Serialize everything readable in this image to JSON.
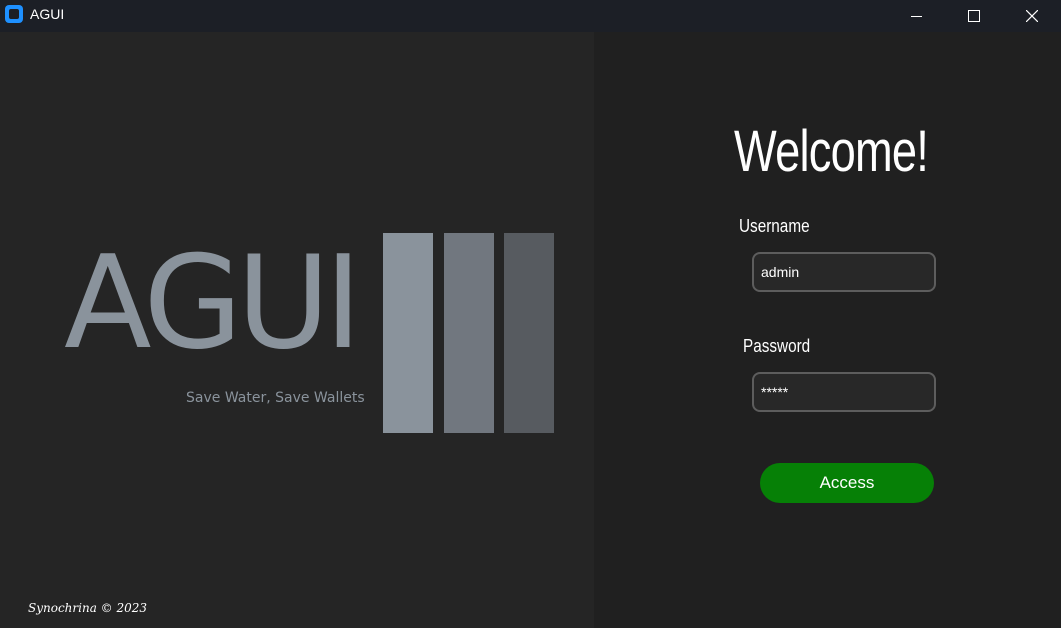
{
  "window": {
    "title": "AGUI"
  },
  "branding": {
    "logo_text": "AGUI",
    "tagline": "Save Water, Save Wallets",
    "copyright": "Synochrina © 2023"
  },
  "login": {
    "heading": "Welcome!",
    "username_label": "Username",
    "username_value": "admin",
    "password_label": "Password",
    "password_value": "*****",
    "access_label": "Access"
  },
  "colors": {
    "access_button": "#068006",
    "logo_gray": "#8a939c"
  }
}
